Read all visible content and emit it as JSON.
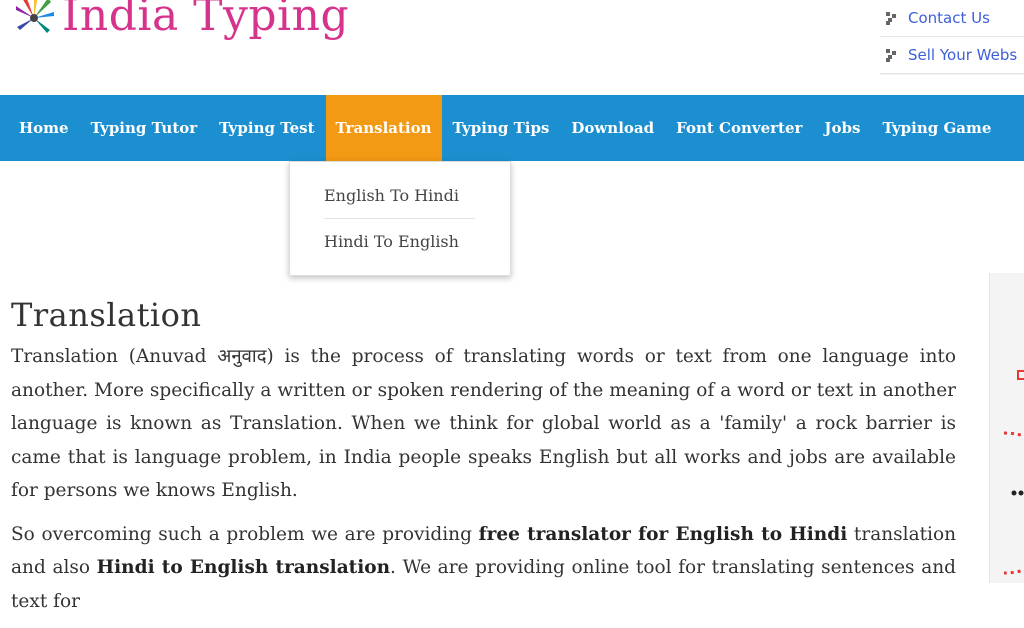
{
  "header": {
    "logo_text": "India Typing",
    "top_links": [
      "Contact Us",
      "Sell Your Webs"
    ]
  },
  "nav": {
    "items": [
      "Home",
      "Typing Tutor",
      "Typing Test",
      "Translation",
      "Typing Tips",
      "Download",
      "Font Converter",
      "Jobs",
      "Typing Game"
    ],
    "active": "Translation"
  },
  "dropdown": {
    "items": [
      "English To Hindi",
      "Hindi To English"
    ]
  },
  "content": {
    "title": "Translation",
    "para1": "Translation (Anuvad अनुवाद) is the process of translating words or text from one language into another. More specifically a written or spoken rendering of the meaning of a word or text in another language is known as Translation. When we think for global world as a 'family' a rock barrier is came that is language problem, in India people speaks English but all works and jobs are available for persons we knows English.",
    "para2_a": "So overcoming such a problem we are providing ",
    "para2_b": "free translator for English to Hindi",
    "para2_c": " translation and also ",
    "para2_d": "Hindi to English translation",
    "para2_e": ". We are providing online tool for translating sentences and text for"
  },
  "colors": {
    "nav_bg": "#1c8fd0",
    "nav_active": "#f39a14",
    "logo": "#d6338d",
    "link": "#3d5fd8"
  }
}
